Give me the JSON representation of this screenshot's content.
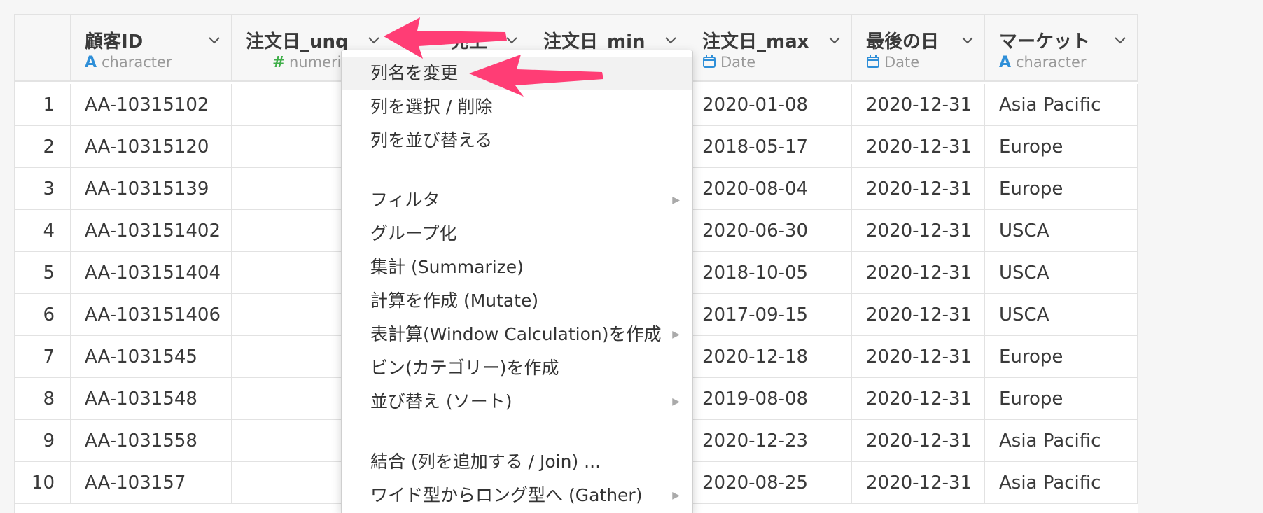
{
  "columns": [
    {
      "key": "id",
      "title": "顧客ID",
      "type_icon": "A",
      "type": "character",
      "type_kind": "char"
    },
    {
      "key": "unq",
      "title": "注文日_unq",
      "type_icon": "#",
      "type": "numeric",
      "type_kind": "num"
    },
    {
      "key": "sales",
      "title": "売上",
      "type_icon": "",
      "type": "",
      "type_kind": "num"
    },
    {
      "key": "min",
      "title": "注文日_min",
      "type_icon": "",
      "type": "",
      "type_kind": "date"
    },
    {
      "key": "max",
      "title": "注文日_max",
      "type_icon": "date-icon",
      "type": "Date",
      "type_kind": "date"
    },
    {
      "key": "last",
      "title": "最後の日",
      "type_icon": "date-icon",
      "type": "Date",
      "type_kind": "date"
    },
    {
      "key": "market",
      "title": "マーケット",
      "type_icon": "A",
      "type": "character",
      "type_kind": "char"
    }
  ],
  "rows": [
    {
      "n": "1",
      "id": "AA-10315102",
      "max": "2020-01-08",
      "last": "2020-12-31",
      "market": "Asia Pacific"
    },
    {
      "n": "2",
      "id": "AA-10315120",
      "max": "2018-05-17",
      "last": "2020-12-31",
      "market": "Europe"
    },
    {
      "n": "3",
      "id": "AA-10315139",
      "max": "2020-08-04",
      "last": "2020-12-31",
      "market": "Europe"
    },
    {
      "n": "4",
      "id": "AA-103151402",
      "max": "2020-06-30",
      "last": "2020-12-31",
      "market": "USCA"
    },
    {
      "n": "5",
      "id": "AA-103151404",
      "max": "2018-10-05",
      "last": "2020-12-31",
      "market": "USCA"
    },
    {
      "n": "6",
      "id": "AA-103151406",
      "max": "2017-09-15",
      "last": "2020-12-31",
      "market": "USCA"
    },
    {
      "n": "7",
      "id": "AA-1031545",
      "max": "2020-12-18",
      "last": "2020-12-31",
      "market": "Europe"
    },
    {
      "n": "8",
      "id": "AA-1031548",
      "max": "2019-08-08",
      "last": "2020-12-31",
      "market": "Europe"
    },
    {
      "n": "9",
      "id": "AA-1031558",
      "max": "2020-12-23",
      "last": "2020-12-31",
      "market": "Asia Pacific"
    },
    {
      "n": "10",
      "id": "AA-103157",
      "max": "2020-08-25",
      "last": "2020-12-31",
      "market": "Asia Pacific"
    }
  ],
  "menu": {
    "items": [
      {
        "label": "列名を変更",
        "highlighted": true,
        "submenu": false
      },
      {
        "label": "列を選択 / 削除",
        "submenu": false
      },
      {
        "label": "列を並び替える",
        "submenu": false
      },
      {
        "label": "フィルタ",
        "submenu": true
      },
      {
        "label": "グループ化",
        "submenu": false
      },
      {
        "label": "集計 (Summarize)",
        "submenu": false
      },
      {
        "label": "計算を作成 (Mutate)",
        "submenu": false
      },
      {
        "label": "表計算(Window Calculation)を作成",
        "submenu": true
      },
      {
        "label": "ビン(カテゴリー)を作成",
        "submenu": false
      },
      {
        "label": "並び替え (ソート)",
        "submenu": true
      },
      {
        "label": "結合 (列を追加する / Join) ...",
        "submenu": false
      },
      {
        "label": "ワイド型からロング型へ (Gather)",
        "submenu": true
      }
    ]
  },
  "colors": {
    "accent_arrow": "#ff3d75",
    "char_type": "#2f8fd8",
    "num_type": "#3fae49"
  }
}
